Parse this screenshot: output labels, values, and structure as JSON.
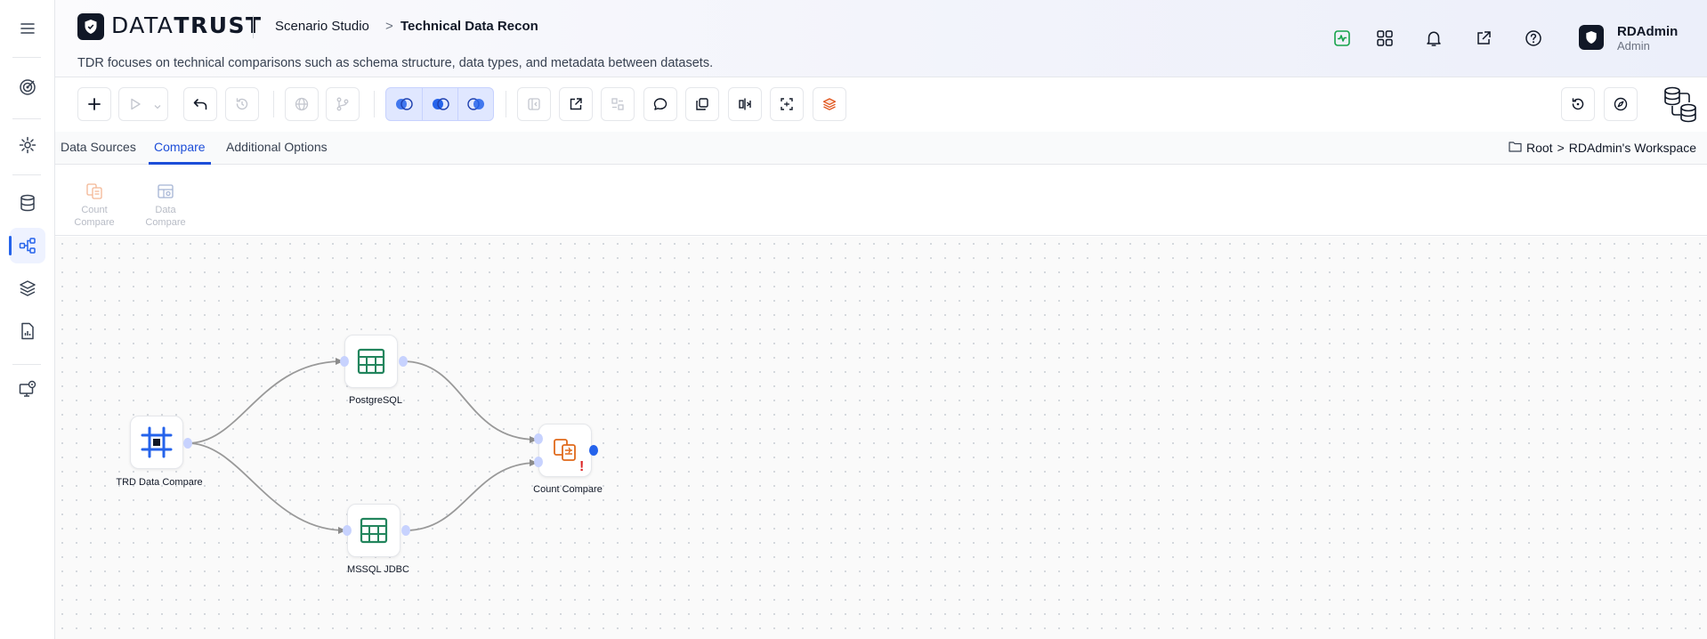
{
  "brand": {
    "name_part1": "DATA",
    "name_part2": "TRUST"
  },
  "breadcrumb": {
    "parent": "Scenario Studio",
    "separator": ">",
    "current": "Technical Data Recon"
  },
  "page": {
    "subtitle": "TDR focuses on technical comparisons such as schema structure, data types, and metadata between datasets."
  },
  "user": {
    "name": "RDAdmin",
    "role": "Admin"
  },
  "header_icons": [
    "activity-icon",
    "apps-grid-icon",
    "bell-icon",
    "external-link-icon",
    "help-icon"
  ],
  "sidebar": {
    "items": [
      {
        "name": "menu-icon"
      },
      {
        "name": "target-icon"
      },
      {
        "name": "gear-icon"
      },
      {
        "name": "database-icon"
      },
      {
        "name": "workflow-icon",
        "active": true
      },
      {
        "name": "layers-icon"
      },
      {
        "name": "report-icon"
      },
      {
        "name": "monitor-icon"
      }
    ]
  },
  "tabs": [
    {
      "label": "Data Sources",
      "active": false
    },
    {
      "label": "Compare",
      "active": true
    },
    {
      "label": "Additional Options",
      "active": false
    }
  ],
  "workspace_path": {
    "root": "Root",
    "separator": ">",
    "workspace": "RDAdmin's Workspace"
  },
  "palette": {
    "items": [
      {
        "line1": "Count",
        "line2": "Compare"
      },
      {
        "line1": "Data",
        "line2": "Compare"
      }
    ]
  },
  "canvas": {
    "nodes": [
      {
        "id": "trd",
        "label": "TRD Data Compare"
      },
      {
        "id": "pg",
        "label": "PostgreSQL"
      },
      {
        "id": "ms",
        "label": "MSSQL JDBC"
      },
      {
        "id": "cc",
        "label": "Count Compare",
        "has_warning": true,
        "warning_text": "!"
      }
    ],
    "edges": [
      {
        "from": "trd",
        "to": "pg"
      },
      {
        "from": "trd",
        "to": "ms"
      },
      {
        "from": "pg",
        "to": "cc"
      },
      {
        "from": "ms",
        "to": "cc"
      }
    ]
  },
  "colors": {
    "accent": "#1d4ed8",
    "table_node": "#22855d",
    "trd_node": "#2563eb",
    "count_compare": "#e06a1b",
    "warning": "#dc2626",
    "activity_icon": "#16a34a"
  }
}
